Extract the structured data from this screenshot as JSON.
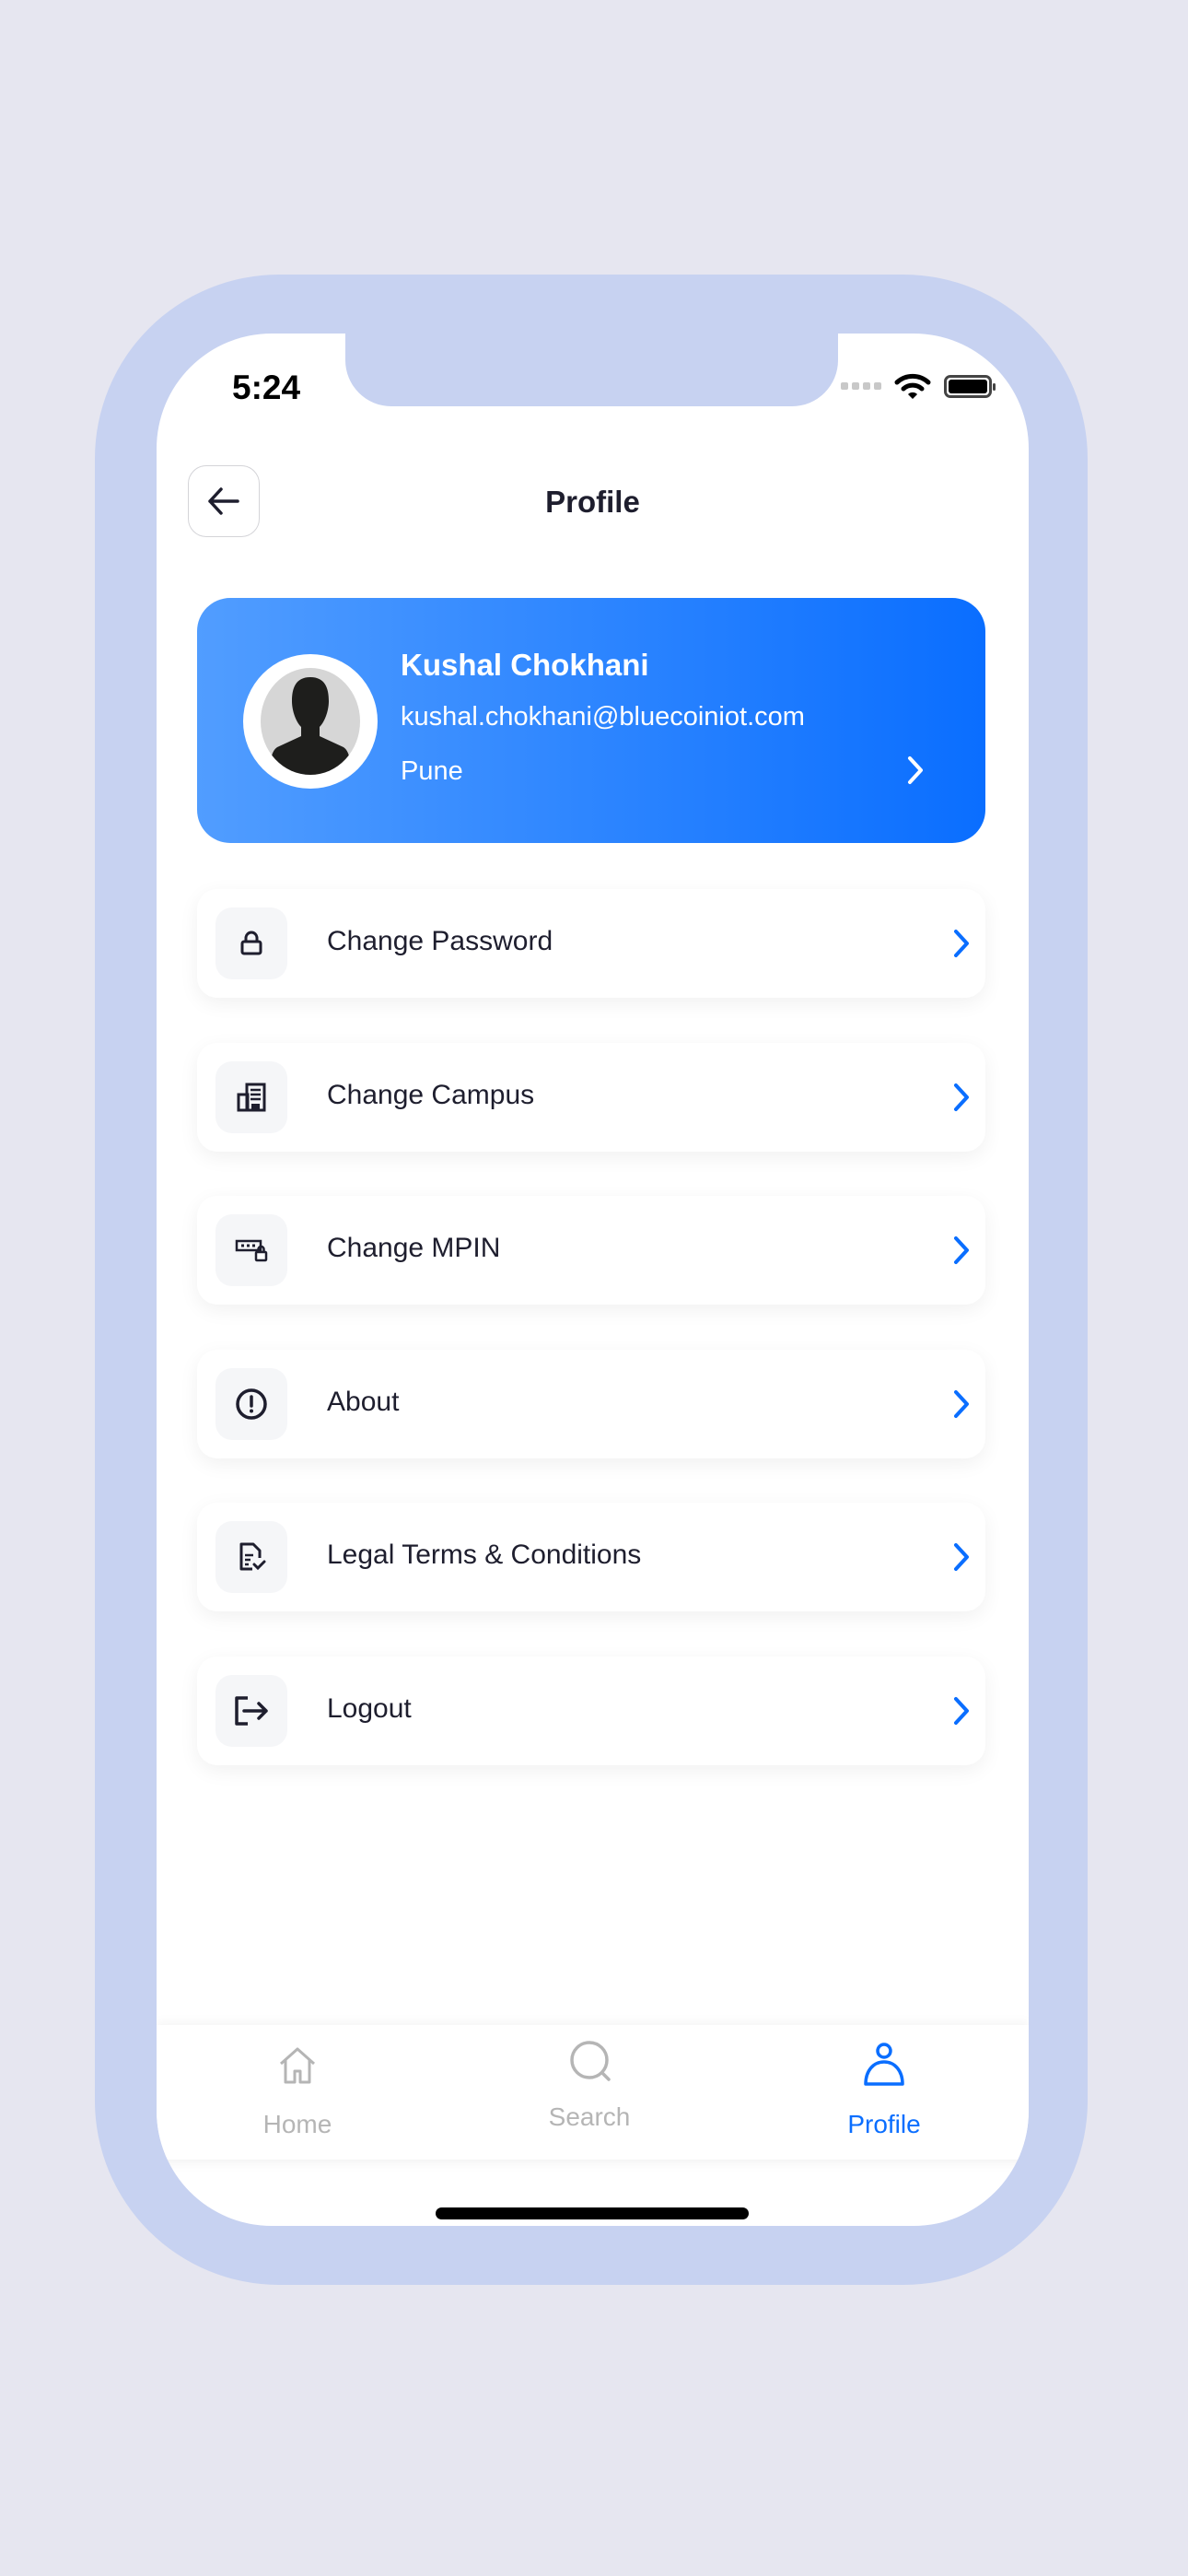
{
  "status_bar": {
    "time": "5:24"
  },
  "header": {
    "title": "Profile"
  },
  "profile_card": {
    "name": "Kushal Chokhani",
    "email": "kushal.chokhani@bluecoiniot.com",
    "city": "Pune"
  },
  "menu": {
    "items": [
      {
        "label": "Change Password",
        "icon": "lock-icon"
      },
      {
        "label": "Change Campus",
        "icon": "building-icon"
      },
      {
        "label": "Change MPIN",
        "icon": "pin-lock-icon"
      },
      {
        "label": "About",
        "icon": "info-circle-icon"
      },
      {
        "label": "Legal Terms & Conditions",
        "icon": "document-check-icon"
      },
      {
        "label": "Logout",
        "icon": "logout-icon"
      }
    ]
  },
  "bottom_nav": {
    "items": [
      {
        "label": "Home",
        "icon": "home-icon",
        "active": false
      },
      {
        "label": "Search",
        "icon": "search-icon",
        "active": false
      },
      {
        "label": "Profile",
        "icon": "user-icon",
        "active": true
      }
    ]
  },
  "colors": {
    "accent": "#0A6EFF",
    "frame": "#C7D2F1",
    "background": "#E6E6F0",
    "inactive": "#B5B5B5"
  }
}
